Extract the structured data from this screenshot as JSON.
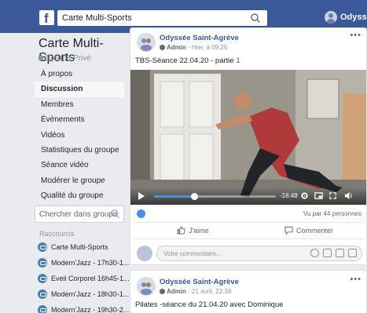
{
  "topbar": {
    "logo": "f",
    "search_value": "Carte Multi-Sports",
    "user_name": "Odyssée"
  },
  "group": {
    "title": "Carte Multi-Sports",
    "privacy": "Groupe Privé"
  },
  "nav": [
    {
      "label": "À propos",
      "active": false
    },
    {
      "label": "Discussion",
      "active": true
    },
    {
      "label": "Membres",
      "active": false
    },
    {
      "label": "Évènements",
      "active": false
    },
    {
      "label": "Vidéos",
      "active": false
    },
    {
      "label": "Statistiques du groupe",
      "active": false
    },
    {
      "label": "Séance vidéo",
      "active": false
    },
    {
      "label": "Modérer le groupe",
      "active": false
    },
    {
      "label": "Qualité du groupe",
      "active": false
    }
  ],
  "group_search": {
    "placeholder": "Chercher dans groupe"
  },
  "shortcuts": {
    "title": "Raccourcis",
    "items": [
      "Carte Multi-Sports",
      "Modern'Jazz - 17h30-1...",
      "Eveil Corporel 16h45-1...",
      "Modern'Jazz - 18h30-1...",
      "Modern'Jazz - 19h30-2..."
    ]
  },
  "post1": {
    "author": "Odyssée Saint-Agrève",
    "role": "Admin",
    "time": "Hier, à 09:26",
    "text_prefix": "TBS-Séance 22.04.20 - partie ",
    "text_num": "1",
    "video": {
      "time_remaining": "-16:48",
      "progress": 0.33
    },
    "views": "Vu par 44 personnes",
    "like_label": "J'aime",
    "comment_label": "Commenter",
    "comment_placeholder": "Votre commentaire..."
  },
  "post2": {
    "author": "Odyssée Saint-Agrève",
    "role": "Admin",
    "time": "21 avril, 22:39",
    "text": "Pilates -séance du 21.04.20 avec Dominique"
  },
  "colors": {
    "brand": "#3b5998",
    "link": "#385898",
    "accent": "#4a90e2"
  }
}
